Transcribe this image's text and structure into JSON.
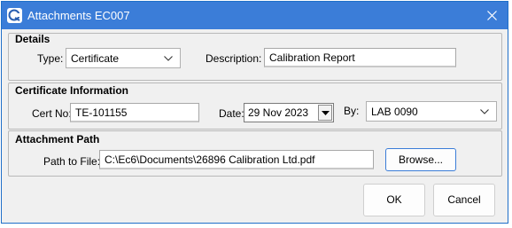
{
  "window": {
    "title": "Attachments EC007"
  },
  "details": {
    "group_title": "Details",
    "type_label": "Type:",
    "type_value": "Certificate",
    "description_label": "Description:",
    "description_value": "Calibration Report"
  },
  "certificate": {
    "group_title": "Certificate Information",
    "cert_no_label": "Cert No:",
    "cert_no_value": "TE-101155",
    "date_label": "Date:",
    "date_value": "29 Nov 2023",
    "by_label": "By:",
    "by_value": "LAB 0090"
  },
  "attachment": {
    "group_title": "Attachment Path",
    "path_label": "Path to File:",
    "path_value": "C:\\Ec6\\Documents\\26896 Calibration Ltd.pdf",
    "browse_label": "Browse..."
  },
  "footer": {
    "ok_label": "OK",
    "cancel_label": "Cancel"
  },
  "icons": {
    "app": "app-logo-icon",
    "close": "close-icon",
    "dropdown": "chevron-down-icon",
    "date_dropdown": "triangle-down-icon"
  },
  "colors": {
    "titlebar": "#3b7dd8",
    "window_border": "#1f6fc8",
    "dialog_bg": "#f0f0f0"
  }
}
